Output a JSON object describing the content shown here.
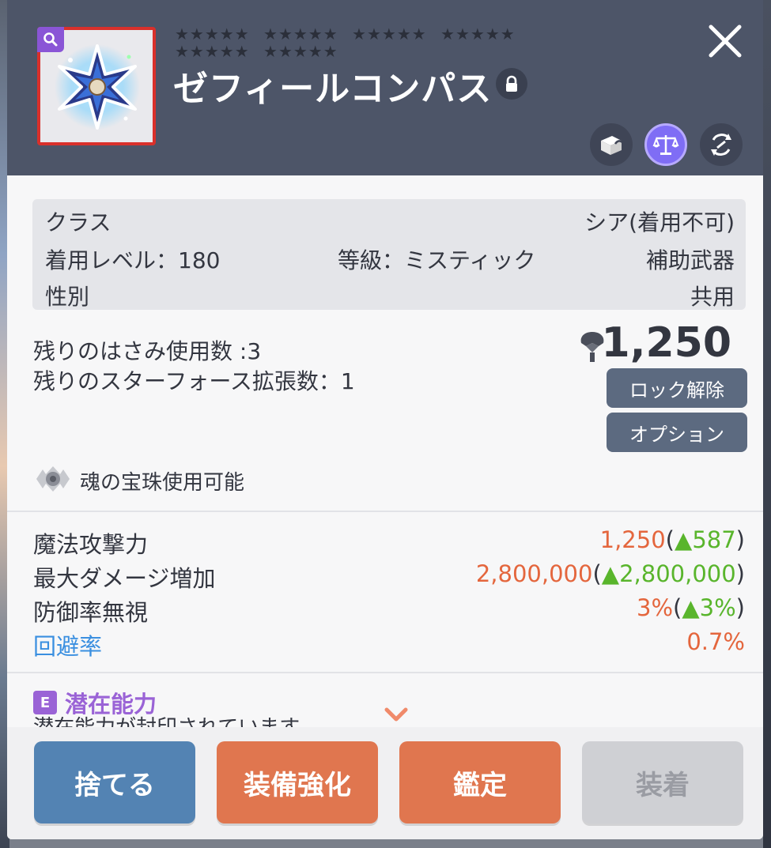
{
  "header": {
    "stars_row1": [
      "★★★★★",
      "★★★★★",
      "★★★★★",
      "★★★★★"
    ],
    "stars_row2": [
      "★★★★★",
      "★★★★★"
    ],
    "item_name": "ゼフィールコンパス",
    "icons": [
      "search-icon",
      "lock-icon",
      "close-icon",
      "box-icon",
      "scale-icon",
      "cycle-icon"
    ],
    "frame_color": "#d9302b"
  },
  "info": {
    "class_label": "クラス",
    "class_value": "シア(着用不可)",
    "level_label": "着用レベル：180",
    "grade_label": "等級：ミスティック",
    "type_value": "補助武器",
    "gender_label": "性別",
    "gender_value": "共用"
  },
  "counts": {
    "scissors": "残りのはさみ使用数 :3",
    "starforce": "残りのスターフォース拡張数：1"
  },
  "meso": {
    "value": "1,250"
  },
  "side_buttons": {
    "unlock": "ロック解除",
    "option": "オプション"
  },
  "soul": {
    "text": "魂の宝珠使用可能"
  },
  "stats": [
    {
      "name": "魔法攻撃力",
      "value": "1,250",
      "open": "(",
      "arrow": "▲",
      "bonus": "587",
      "close": ")"
    },
    {
      "name": "最大ダメージ増加",
      "value": "2,800,000",
      "open": "(",
      "arrow": "▲",
      "bonus": "2,800,000",
      "close": ")"
    },
    {
      "name": "防御率無視",
      "value": "3%",
      "open": "(",
      "arrow": "▲",
      "bonus": "3%",
      "close": ")"
    },
    {
      "name": "回避率",
      "value": "0.7%"
    }
  ],
  "potential": {
    "badge": "E",
    "title": "潜在能力",
    "subtitle": "潜在能力が封印されています"
  },
  "buttons": {
    "discard": "捨てる",
    "enhance": "装備強化",
    "appraise": "鑑定",
    "equip": "装着"
  },
  "colors": {
    "header_bg": "#4d5568",
    "accent_orange": "#e0764f",
    "value_orange": "#e4663d",
    "bonus_green": "#59b52c",
    "potential_purple": "#9a63d6",
    "discard_blue": "#5383b3"
  }
}
